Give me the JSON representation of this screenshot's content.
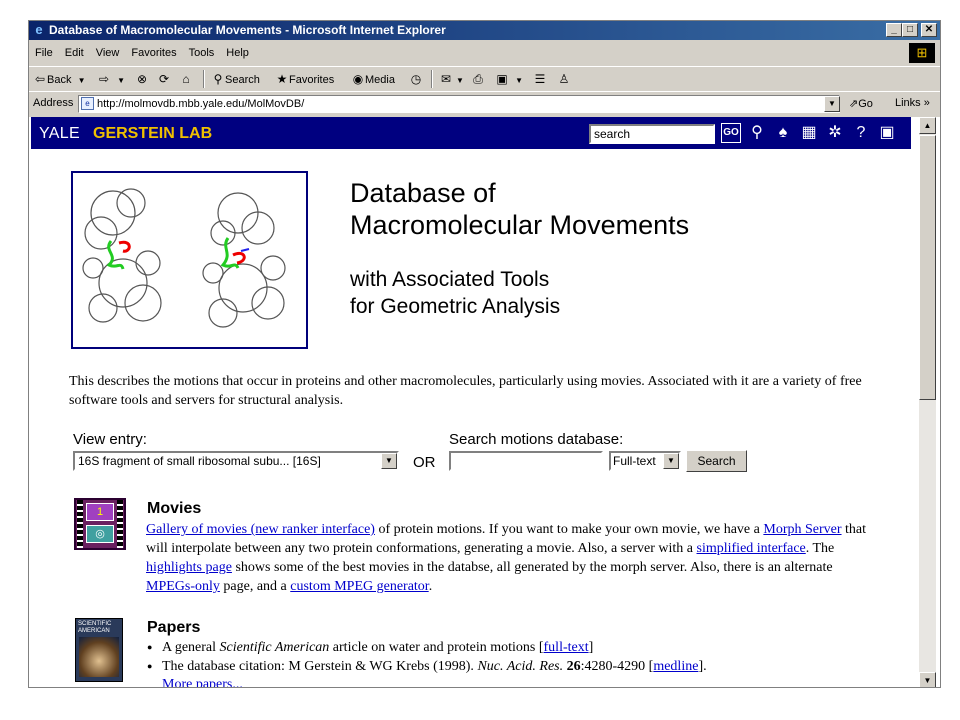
{
  "window": {
    "title": "Database of Macromolecular Movements - Microsoft Internet Explorer",
    "min": "_",
    "max": "□",
    "close": "✕"
  },
  "menu": [
    "File",
    "Edit",
    "View",
    "Favorites",
    "Tools",
    "Help"
  ],
  "toolbar": {
    "back": "Back",
    "search": "Search",
    "favorites": "Favorites",
    "media": "Media"
  },
  "address": {
    "label": "Address",
    "url": "http://molmovdb.mbb.yale.edu/MolMovDB/",
    "go": "Go",
    "links": "Links"
  },
  "header": {
    "yale": "YALE",
    "lab": "GERSTEIN LAB",
    "search_value": "search",
    "go": "GO"
  },
  "page": {
    "title_line1": "Database of",
    "title_line2": "Macromolecular Movements",
    "subtitle_line1": "with Associated Tools",
    "subtitle_line2": "for Geometric Analysis",
    "description": "This describes the motions that occur in proteins and other macromolecules, particularly using movies. Associated with it are a variety of free software tools and servers for structural analysis."
  },
  "forms": {
    "view_label": "View entry:",
    "view_selected": "16S fragment of small ribosomal subu... [16S]",
    "or": "OR",
    "search_label": "Search motions database:",
    "search_value": "",
    "mode_selected": "Full-text",
    "search_button": "Search"
  },
  "movies": {
    "heading": "Movies",
    "icon_frame1": "1",
    "link_gallery": "Gallery of movies (new ranker interface)",
    "t1": " of protein motions. If you want to make your own movie, we have a ",
    "link_morph": "Morph Server",
    "t2": " that will interpolate between any two protein conformations, generating a movie. Also, a server with a ",
    "link_simplified": "simplified interface",
    "t3": ". The ",
    "link_highlights": "highlights page",
    "t4": " shows some of the best movies in the databse, all generated by the morph server. Also, there is an alternate ",
    "link_mpegs": "MPEGs-only",
    "t5": " page, and a ",
    "link_custom": "custom MPEG generator",
    "t6": "."
  },
  "papers": {
    "heading": "Papers",
    "icon_caption": "SCIENTIFIC AMERICAN",
    "item1_a": "A general ",
    "item1_em": "Scientific American",
    "item1_b": " article on water and protein motions [",
    "item1_link": "full-text",
    "item1_c": "]",
    "item2_a": "The database citation: M Gerstein & WG Krebs (1998). ",
    "item2_em": "Nuc. Acid. Res.",
    "item2_b": " ",
    "item2_strong": "26",
    "item2_c": ":4280-4290 [",
    "item2_link": "medline",
    "item2_d": "].",
    "more": "More papers..."
  }
}
